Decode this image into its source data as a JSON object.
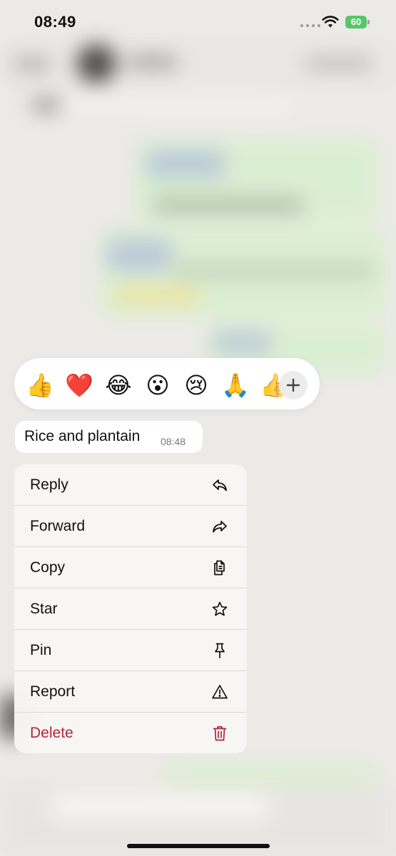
{
  "status_bar": {
    "time": "08:49",
    "battery": "60"
  },
  "reactions": {
    "emojis": [
      {
        "name": "thumbs-up-emoji",
        "glyph": "👍"
      },
      {
        "name": "red-heart-emoji",
        "glyph": "❤️"
      },
      {
        "name": "tears-of-joy-emoji",
        "glyph": "😂"
      },
      {
        "name": "surprised-emoji",
        "glyph": "😮"
      },
      {
        "name": "crying-emoji",
        "glyph": "😢"
      },
      {
        "name": "folded-hands-emoji",
        "glyph": "🙏"
      },
      {
        "name": "thumbs-up-partial-emoji",
        "glyph": "👍"
      }
    ],
    "add_icon": "plus-icon"
  },
  "message": {
    "text": "Rice and plantain",
    "time": "08:48"
  },
  "menu": {
    "items": [
      {
        "label": "Reply",
        "icon": "reply-icon"
      },
      {
        "label": "Forward",
        "icon": "forward-icon"
      },
      {
        "label": "Copy",
        "icon": "copy-icon"
      },
      {
        "label": "Star",
        "icon": "star-icon"
      },
      {
        "label": "Pin",
        "icon": "pin-icon"
      },
      {
        "label": "Report",
        "icon": "report-icon"
      },
      {
        "label": "Delete",
        "icon": "trash-icon"
      }
    ],
    "danger_color": "#b3263a"
  }
}
